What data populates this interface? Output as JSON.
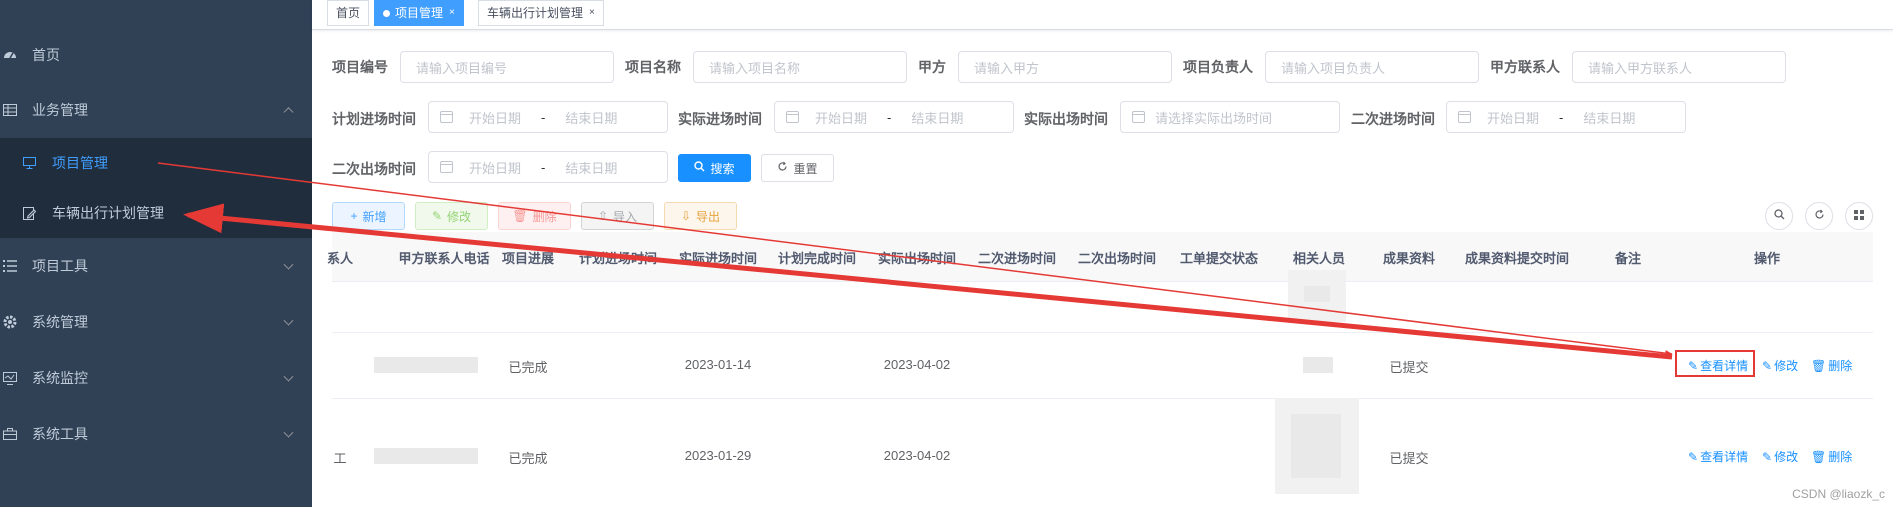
{
  "sidebar": {
    "items": [
      {
        "label": "首页",
        "icon": "dashboard-icon"
      },
      {
        "label": "业务管理",
        "icon": "table-icon",
        "expanded": true,
        "children": [
          {
            "label": "项目管理",
            "icon": "monitor-icon",
            "active": true
          },
          {
            "label": "车辆出行计划管理",
            "icon": "edit-icon",
            "active": false
          }
        ]
      },
      {
        "label": "项目工具",
        "icon": "list-icon"
      },
      {
        "label": "系统管理",
        "icon": "gear-icon"
      },
      {
        "label": "系统监控",
        "icon": "monitor-icon"
      },
      {
        "label": "系统工具",
        "icon": "toolbox-icon"
      }
    ]
  },
  "tags": [
    {
      "label": "首页",
      "active": false
    },
    {
      "label": "项目管理",
      "active": true,
      "closable": "×"
    },
    {
      "label": "车辆出行计划管理",
      "active": false,
      "closable": "×"
    }
  ],
  "form": {
    "project_no": {
      "label": "项目编号",
      "placeholder": "请输入项目编号"
    },
    "project_name": {
      "label": "项目名称",
      "placeholder": "请输入项目名称"
    },
    "party_a": {
      "label": "甲方",
      "placeholder": "请输入甲方"
    },
    "owner": {
      "label": "项目负责人",
      "placeholder": "请输入项目负责人"
    },
    "party_a_contact": {
      "label": "甲方联系人",
      "placeholder": "请输入甲方联系人"
    },
    "plan_entry": {
      "label": "计划进场时间",
      "start": "开始日期",
      "sep": "-",
      "end": "结束日期"
    },
    "actual_entry": {
      "label": "实际进场时间",
      "start": "开始日期",
      "sep": "-",
      "end": "结束日期"
    },
    "actual_exit": {
      "label": "实际出场时间",
      "placeholder": "请选择实际出场时间"
    },
    "second_entry": {
      "label": "二次进场时间",
      "start": "开始日期",
      "sep": "-",
      "end": "结束日期"
    },
    "second_exit": {
      "label": "二次出场时间",
      "start": "开始日期",
      "sep": "-",
      "end": "结束日期"
    },
    "search_label": "搜索",
    "reset_label": "重置"
  },
  "toolbar": {
    "add_label": "新增",
    "edit_label": "修改",
    "delete_label": "删除",
    "import_label": "导入",
    "export_label": "导出"
  },
  "table": {
    "headers": [
      "系人",
      "甲方联系人电话",
      "项目进展",
      "计划进场时间",
      "实际进场时间",
      "计划完成时间",
      "实际出场时间",
      "二次进场时间",
      "二次出场时间",
      "工单提交状态",
      "相关人员",
      "成果资料",
      "成果资料提交时间",
      "备注",
      "操作"
    ],
    "rows": [
      {
        "first": "",
        "progress": "已完成",
        "actual_entry": "2023-01-14",
        "actual_exit": "2023-04-02",
        "result": "已提交"
      },
      {
        "first": "工",
        "progress": "已完成",
        "actual_entry": "2023-01-29",
        "actual_exit": "2023-04-02",
        "result": "已提交"
      }
    ],
    "actions": {
      "view": "查看详情",
      "edit": "修改",
      "delete": "删除"
    }
  },
  "colors": {
    "sidebar_bg": "#304156",
    "submenu_bg": "#1f2d3d",
    "primary": "#1890ff",
    "annotation": "#e53935"
  },
  "watermark": "CSDN @liaozk_c"
}
